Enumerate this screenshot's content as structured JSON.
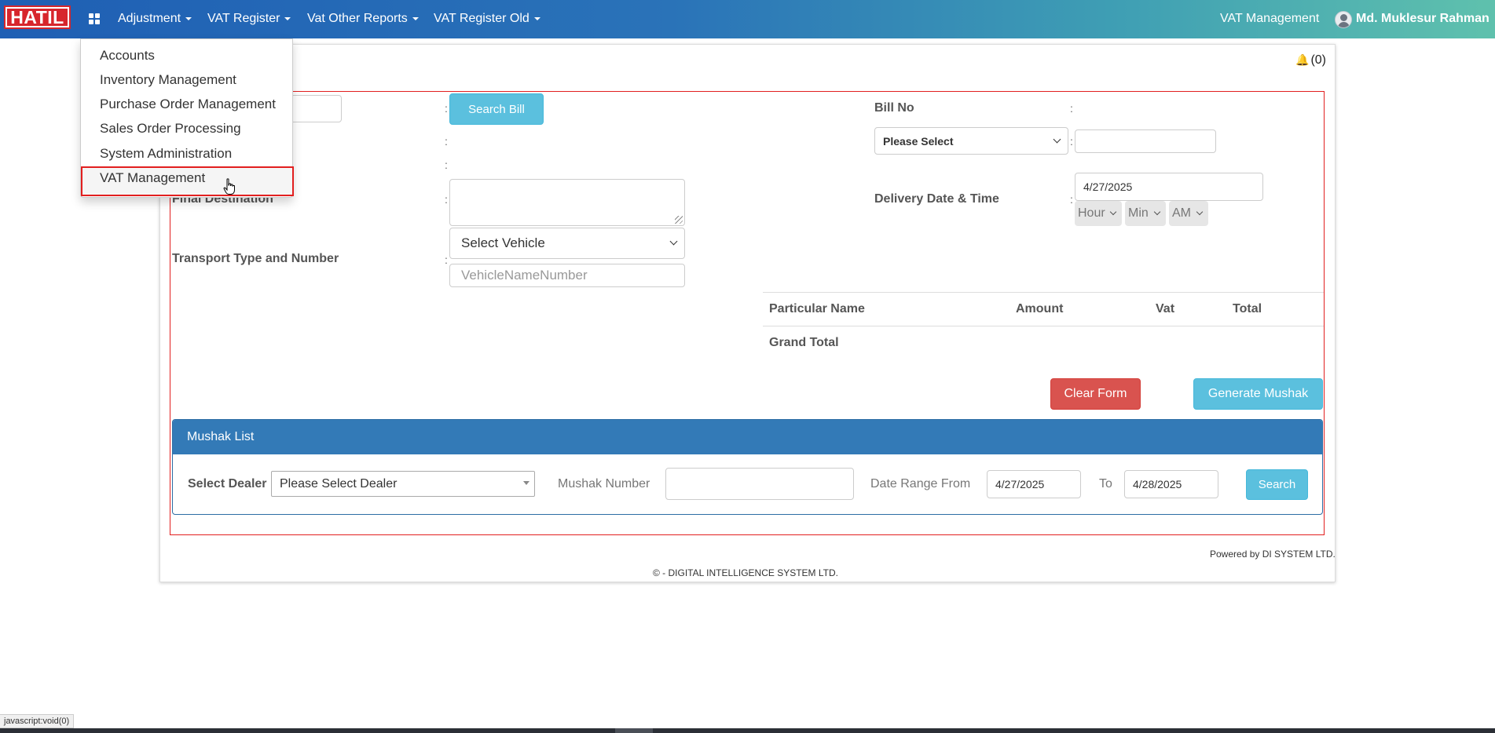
{
  "navbar": {
    "brand": "HATIL",
    "menu": [
      {
        "label": "Adjustment"
      },
      {
        "label": "VAT Register"
      },
      {
        "label": "Vat Other Reports"
      },
      {
        "label": "VAT Register Old"
      }
    ],
    "module_name": "VAT Management",
    "user_name": "Md. Muklesur Rahman"
  },
  "dropdown": {
    "items": [
      "Accounts",
      "Inventory Management",
      "Purchase Order Management",
      "Sales Order Processing",
      "System Administration",
      "VAT Management"
    ],
    "hovered_item": "VAT Management"
  },
  "notifications": {
    "count_label": "(0)"
  },
  "form": {
    "search_bill_label": "Search Bill",
    "final_destination_label": "Final Destination",
    "transport_label": "Transport Type and Number",
    "vehicle_select_value": "Select Vehicle",
    "vehicle_name_placeholder": "VehicleNameNumber",
    "bill_no_label": "Bill No",
    "bill_select_value": "Please Select",
    "delivery_label": "Delivery Date & Time",
    "delivery_date": "4/27/2025",
    "hour_value": "Hour",
    "min_value": "Min",
    "ampm_value": "AM",
    "colon": ":"
  },
  "particulars_table": {
    "headers": [
      "Particular Name",
      "Amount",
      "Vat",
      "Total"
    ],
    "grand_total_label": "Grand Total"
  },
  "actions": {
    "clear_label": "Clear Form",
    "generate_label": "Generate Mushak"
  },
  "mushak_list": {
    "title": "Mushak List",
    "dealer_label": "Select Dealer",
    "dealer_value": "Please Select Dealer",
    "number_label": "Mushak Number",
    "number_value": "",
    "date_from_label": "Date Range From",
    "date_from": "4/27/2025",
    "to_label": "To",
    "date_to": "4/28/2025",
    "search_label": "Search"
  },
  "footer": {
    "powered_by": "Powered by DI SYSTEM LTD.",
    "copyright": "© - DIGITAL INTELLIGENCE SYSTEM LTD."
  },
  "status_bar": {
    "text": "javascript:void(0)"
  },
  "colors": {
    "navbar_start": "#1f5fb4",
    "navbar_end": "#5fc1ad",
    "brand_red": "#d7262c",
    "highlight_red": "#e21f1f",
    "info": "#5bc0de",
    "danger": "#d9534f",
    "primary": "#337ab7"
  }
}
